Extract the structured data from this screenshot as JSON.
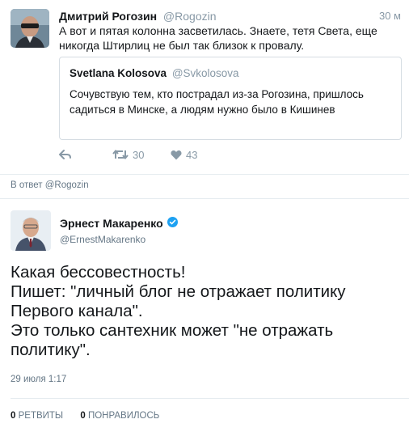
{
  "tweet": {
    "author_name": "Дмитрий Рогозин",
    "author_handle": "@Rogozin",
    "time": "30 м",
    "text": "А вот и пятая колонна засветилась. Знаете, тетя Света, еще никогда Штирлиц не был так близок к провалу.",
    "quoted": {
      "author_name": "Svetlana Kolosova",
      "author_handle": "@Svkolosova",
      "text": "Сочувствую тем, кто пострадал из-за Рогозина, пришлось садиться в Минске, а людям нужно было в Кишинев"
    },
    "actions": {
      "reply_icon": "reply-icon",
      "retweet_icon": "retweet-icon",
      "retweet_count": "30",
      "like_icon": "heart-icon",
      "like_count": "43"
    }
  },
  "reply_context": "В ответ @Rogozin",
  "reply": {
    "author_name": "Эрнест Макаренко",
    "author_handle": "@ErnestMakarenko",
    "verified_icon": "verified-badge-icon",
    "text": "Какая бессовестность!\nПишет: \"личный блог не отражает политику Первого канала\".\nЭто только сантехник может \"не отражать политику\".",
    "date": "29 июля 1:17",
    "retweets_count": "0",
    "retweets_label": "РЕТВИТЫ",
    "likes_count": "0",
    "likes_label": "ПОНРАВИЛОСЬ"
  },
  "colors": {
    "muted": "#8899a6",
    "border": "#e6ecf0",
    "verified": "#1da1f2"
  }
}
